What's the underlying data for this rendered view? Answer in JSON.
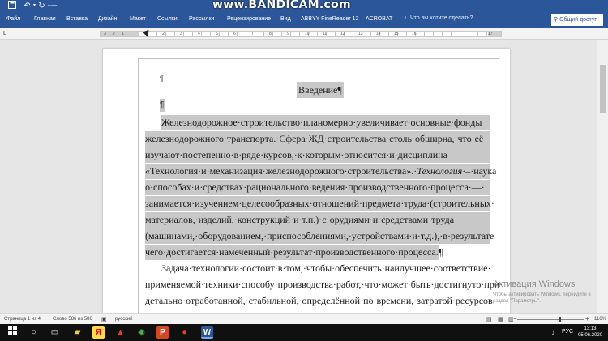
{
  "watermark": "www.BANDICAM.com",
  "quick_access": {
    "save_icon": "save-icon",
    "undo_icon": "undo-icon",
    "redo_icon": "redo-icon"
  },
  "ribbon": {
    "tabs": [
      "Файл",
      "Главная",
      "Вставка",
      "Дизайн",
      "Макет",
      "Ссылки",
      "Рассылки",
      "Рецензирование",
      "Вид",
      "ABBYY FineReader 12",
      "ACROBAT"
    ],
    "tell_me": "Что вы хотите сделать?",
    "share": "Общий доступ"
  },
  "ruler": {
    "numbers": [
      "3",
      "2",
      "1",
      "1",
      "2",
      "3",
      "4",
      "5",
      "6",
      "7",
      "8",
      "9",
      "10",
      "11",
      "12",
      "13",
      "14",
      "15",
      "16",
      "17"
    ]
  },
  "document": {
    "heading": "Введение¶",
    "lines": [
      "Железнодорожное·строительство·планомерно·увеличивает·основные·фонды",
      "железнодорожного·транспорта.·Сфера·ЖД·строительства·столь·обширна,·что·её",
      "изучают·постепенно·в·ряде·курсов,·к·которым·относится·и·дисциплина",
      "«Технология·и·механизация·железнодорожного·строительства».·",
      "о·способах·и·средствах·рационального·ведения·производственного·процесса·—·",
      "занимается·изучением·целесообразных·отношений·предмета·труда·(строительных·",
      "материалов,·изделий,·конструкций·и·т.п.)·с·орудиями·и·средствами·труда",
      "(машинами,·оборудованием,·приспособлениями,·устройствами·и·т.д.),·в·результате",
      "чего·достигается·намеченный·результат·производственного·процесса.¶",
      "Задача·технологии·состоит·в·том,·чтобы·обеспечить·наилучшее·соответствие·",
      "применяемой·техники·способу·производства·работ,·что·может·быть·достигнуто·при·",
      "детально·отработанной,·стабильной,·определённой·по·времени,·затратой·ресурсов"
    ],
    "italic_term": "Технология",
    "italic_tail": "·–·наука"
  },
  "activation": {
    "line1": "Активация Windows",
    "line2": "Чтобы активировать Windows, перейдите в",
    "line3": "раздел \"Параметры\"."
  },
  "status": {
    "page": "Страница 1 из 4",
    "words": "Слово 586 из 586",
    "language": "русский",
    "zoom_minus": "−",
    "zoom_plus": "+",
    "zoom": "116%"
  },
  "taskbar": {
    "lang": "РУС",
    "time": "13:13",
    "date": "05.06.2020"
  },
  "colors": {
    "word_blue": "#2b579a",
    "selection": "#c8c8c8",
    "taskbar": "#101010"
  }
}
